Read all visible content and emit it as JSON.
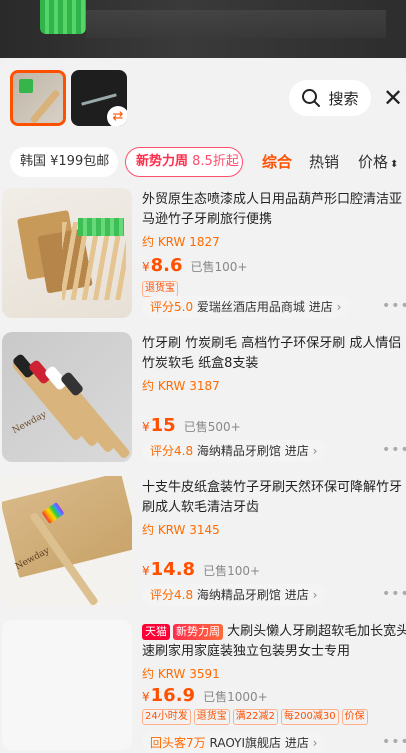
{
  "header": {
    "search_label": "搜索",
    "swap_icon": "⇄"
  },
  "filters": {
    "korea_chip": "韩国 ¥199包邮",
    "new_chip_a": "新势力周",
    "new_chip_b": " 8.5折起",
    "sort_comprehensive": "综合",
    "sort_sales": "热销",
    "sort_price": "价格"
  },
  "products": [
    {
      "title_1": "外贸原生态喷漆成人日用品葫芦形口腔清洁亚",
      "title_2": "马逊竹子牙刷旅行便携",
      "krw": "约 KRW 1827",
      "yen": "¥",
      "price": "8.6",
      "sold": "已售100+",
      "tags": [
        "退货宝"
      ],
      "shop_score": "评分5.0",
      "shop_name": "爱瑞丝酒店用品商城",
      "shop_enter": "进店"
    },
    {
      "title_1": "竹牙刷 竹炭刷毛 高档竹子环保牙刷 成人情侣",
      "title_2": "竹炭软毛 纸盒8支装",
      "krw": "约 KRW 3187",
      "yen": "¥",
      "price": "15",
      "sold": "已售500+",
      "shop_score": "评分4.8",
      "shop_name": "海纳精品牙刷馆",
      "shop_enter": "进店",
      "image_label": "Newday"
    },
    {
      "title_1": "十支牛皮纸盒装竹子牙刷天然环保可降解竹牙",
      "title_2": "刷成人软毛清洁牙齿",
      "krw": "约 KRW 3145",
      "yen": "¥",
      "price": "14.8",
      "sold": "已售100+",
      "shop_score": "评分4.8",
      "shop_name": "海纳精品牙刷馆",
      "shop_enter": "进店",
      "image_label": "Newday"
    },
    {
      "badge_tmall": "天猫",
      "badge_new": "新势力周",
      "title_1": "大刷头懒人牙刷超软毛加长宽头",
      "title_2": "速刷家用家庭装独立包装男女士专用",
      "krw": "约 KRW 3591",
      "yen": "¥",
      "price": "16.9",
      "sold": "已售1000+",
      "tags": [
        "24小时发",
        "退货宝",
        "满22减2",
        "每200减30",
        "价保"
      ],
      "shop_score": "回头客7万",
      "shop_name": "RAOYI旗舰店",
      "shop_enter": "进店"
    }
  ],
  "colors": {
    "accent": "#ff5000",
    "krw": "#ff6a00",
    "new_chip": "#ff4d6d"
  }
}
